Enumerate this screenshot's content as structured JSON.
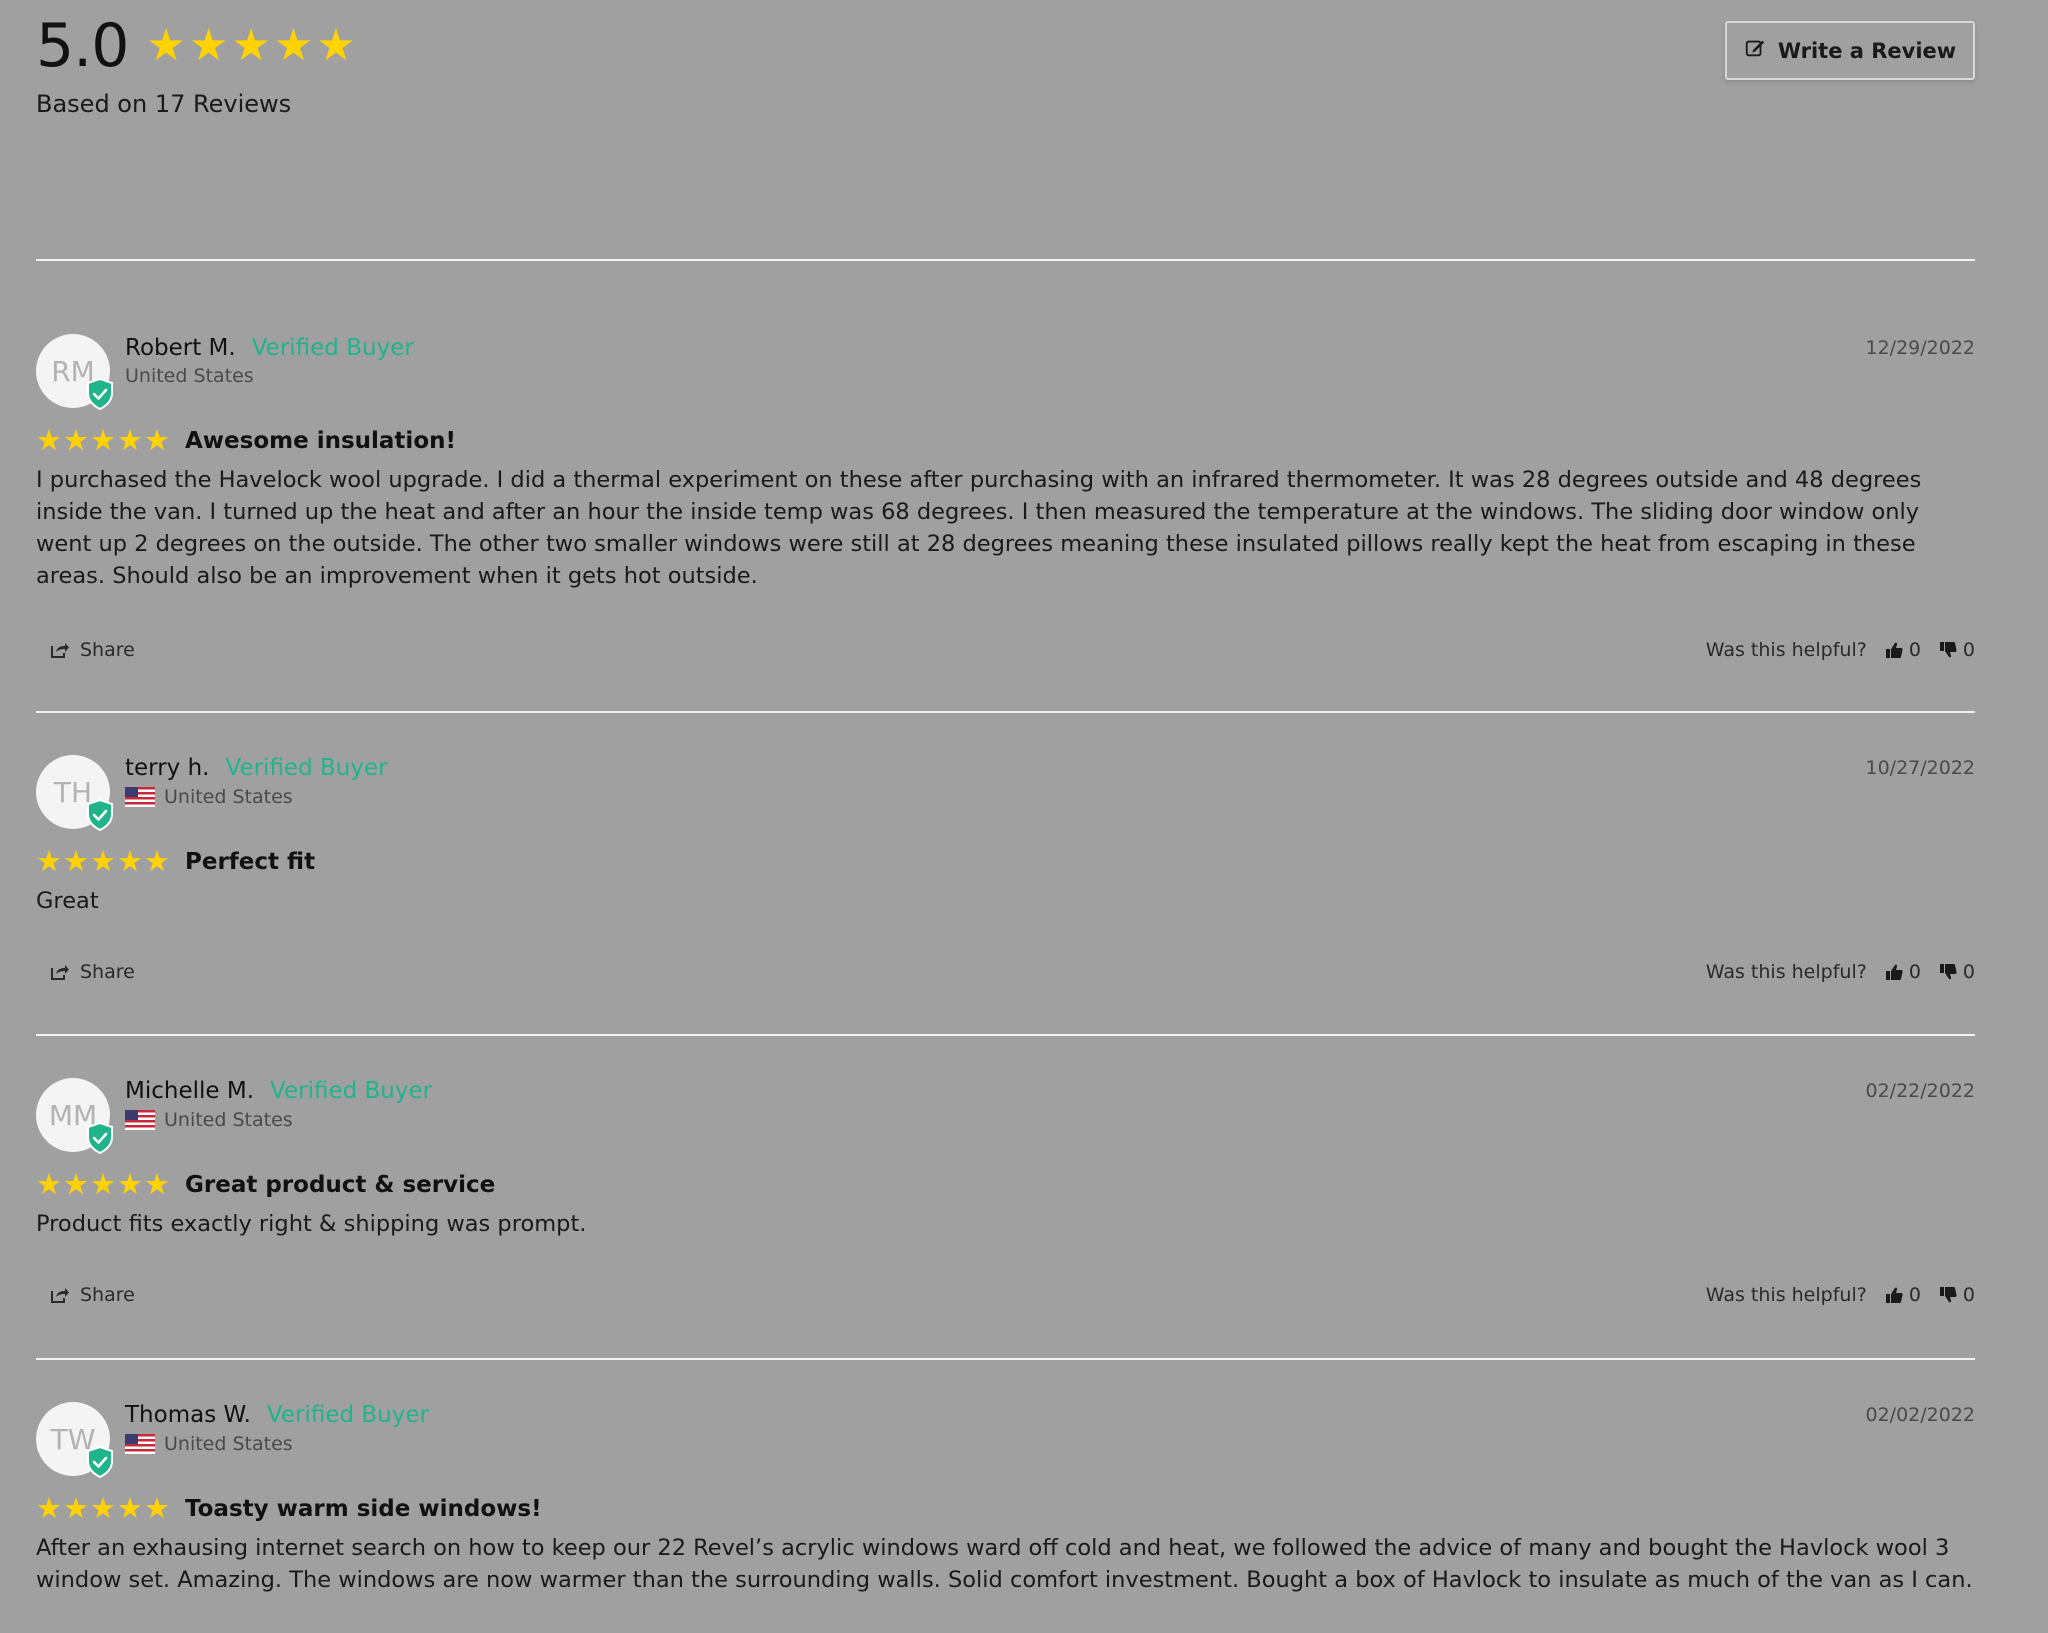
{
  "summary": {
    "average": "5.0",
    "rating_stars": 5,
    "based_on": "Based on 17 Reviews",
    "write_review_label": "Write a Review"
  },
  "colors": {
    "star": "#ffd200",
    "verified": "#1fb48a",
    "background": "#a0a0a0"
  },
  "reviews": [
    {
      "initials": "RM",
      "author": "Robert M.",
      "verified": "Verified Buyer",
      "location": "United States",
      "show_flag": false,
      "date": "12/29/2022",
      "rating": 5,
      "title": "Awesome insulation!",
      "body": "I purchased the Havelock wool upgrade. I did a thermal experiment on these after purchasing with an infrared thermometer. It was 28 degrees outside and 48 degrees inside the van. I turned up the heat and after an hour the inside temp was 68 degrees. I then measured the temperature at the windows. The sliding door window only went up 2 degrees on the outside. The other two smaller windows were still at 28 degrees meaning these insulated pillows really kept the heat from escaping in these areas. Should also be an improvement when it gets hot outside.",
      "share_label": "Share",
      "helpful_label": "Was this helpful?",
      "thumbs_up": "0",
      "thumbs_down": "0"
    },
    {
      "initials": "TH",
      "author": "terry h.",
      "verified": "Verified Buyer",
      "location": "United States",
      "show_flag": true,
      "date": "10/27/2022",
      "rating": 5,
      "title": "Perfect fit",
      "body": "Great",
      "share_label": "Share",
      "helpful_label": "Was this helpful?",
      "thumbs_up": "0",
      "thumbs_down": "0"
    },
    {
      "initials": "MM",
      "author": "Michelle M.",
      "verified": "Verified Buyer",
      "location": "United States",
      "show_flag": true,
      "date": "02/22/2022",
      "rating": 5,
      "title": "Great product & service",
      "body": "Product fits exactly right & shipping was prompt.",
      "share_label": "Share",
      "helpful_label": "Was this helpful?",
      "thumbs_up": "0",
      "thumbs_down": "0"
    },
    {
      "initials": "TW",
      "author": "Thomas W.",
      "verified": "Verified Buyer",
      "location": "United States",
      "show_flag": true,
      "date": "02/02/2022",
      "rating": 5,
      "title": "Toasty warm side windows!",
      "body": "After an exhausing internet search on how to keep our 22 Revel’s acrylic windows ward off cold and heat, we followed the advice of many and bought the Havlock wool 3 window set. Amazing. The windows are now warmer than the surrounding walls. Solid comfort investment. Bought a box of Havlock to insulate as much of the van as I can.",
      "share_label": "Share",
      "helpful_label": "Was this helpful?",
      "thumbs_up": "0",
      "thumbs_down": "0"
    }
  ]
}
